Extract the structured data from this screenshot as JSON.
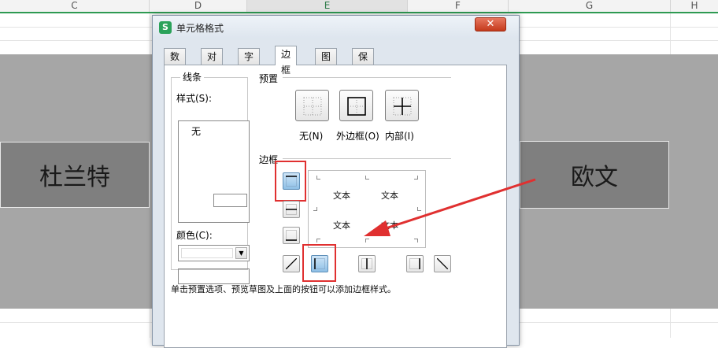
{
  "sheet": {
    "columns": [
      "C",
      "D",
      "E",
      "F",
      "G",
      "H"
    ],
    "left_cell_text": "杜兰特",
    "right_cell_text": "欧文"
  },
  "dialog": {
    "title": "单元格格式",
    "close_label": "✕",
    "tabs": [
      "数字",
      "对齐",
      "字体",
      "边框",
      "图案",
      "保护"
    ],
    "active_tab": "边框",
    "line_group_title": "线条",
    "style_label": "样式(S):",
    "style_none": "无",
    "color_label": "颜色(C):",
    "preset_title": "预置",
    "presets": [
      "无(N)",
      "外边框(O)",
      "内部(I)"
    ],
    "border_title": "边框",
    "preview_texts": [
      "文本",
      "文本",
      "文本",
      "文本"
    ],
    "hint": "单击预置选项、预览草图及上面的按钮可以添加边框样式。"
  },
  "colors": {
    "accent_green": "#2e9a52",
    "highlight_red": "#e03030",
    "band_gray": "#a6a6a6",
    "name_cell_gray": "#7f7f7f"
  }
}
